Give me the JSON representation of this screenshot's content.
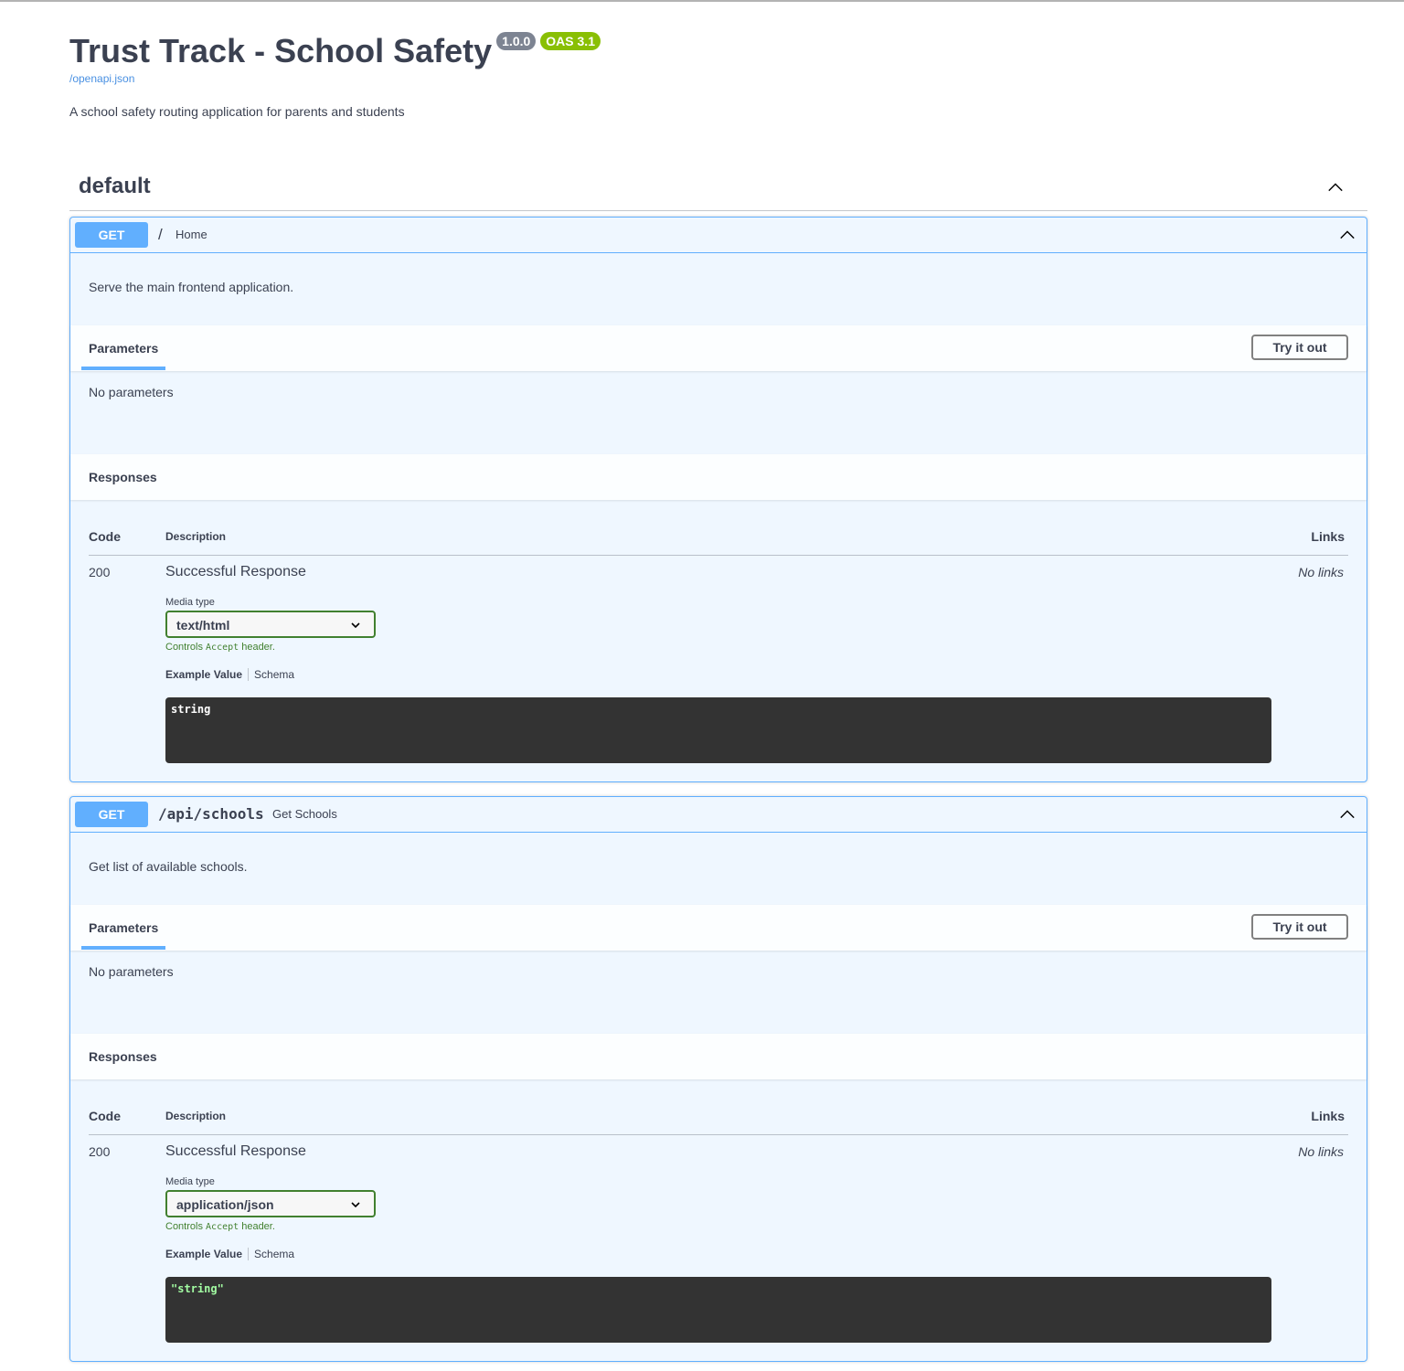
{
  "info": {
    "title": "Trust Track - School Safety",
    "version": "1.0.0",
    "oas": "OAS 3.1",
    "spec_link": "/openapi.json",
    "description": "A school safety routing application for parents and students"
  },
  "tag": {
    "name": "default",
    "icon": "chevron-up-icon"
  },
  "operations": [
    {
      "method": "GET",
      "path": "/",
      "summary": "Home",
      "description": "Serve the main frontend application.",
      "parameters_title": "Parameters",
      "try_label": "Try it out",
      "no_params": "No parameters",
      "responses_title": "Responses",
      "col_code": "Code",
      "col_description": "Description",
      "col_links": "Links",
      "response": {
        "code": "200",
        "description": "Successful Response",
        "links": "No links",
        "media_label": "Media type",
        "media_type": "text/html",
        "controls_prefix": "Controls ",
        "controls_mono": "Accept",
        "controls_suffix": " header.",
        "example_tab": "Example Value",
        "schema_tab": "Schema",
        "example": "string"
      }
    },
    {
      "method": "GET",
      "path": "/api/schools",
      "summary": "Get Schools",
      "description": "Get list of available schools.",
      "parameters_title": "Parameters",
      "try_label": "Try it out",
      "no_params": "No parameters",
      "responses_title": "Responses",
      "col_code": "Code",
      "col_description": "Description",
      "col_links": "Links",
      "response": {
        "code": "200",
        "description": "Successful Response",
        "links": "No links",
        "media_label": "Media type",
        "media_type": "application/json",
        "controls_prefix": "Controls ",
        "controls_mono": "Accept",
        "controls_suffix": " header.",
        "example_tab": "Example Value",
        "schema_tab": "Schema",
        "example": "\"string\""
      }
    }
  ],
  "colors": {
    "get": "#61affe",
    "oas_badge": "#89bf04",
    "version_badge": "#7d8492",
    "media_border": "#41802f"
  }
}
